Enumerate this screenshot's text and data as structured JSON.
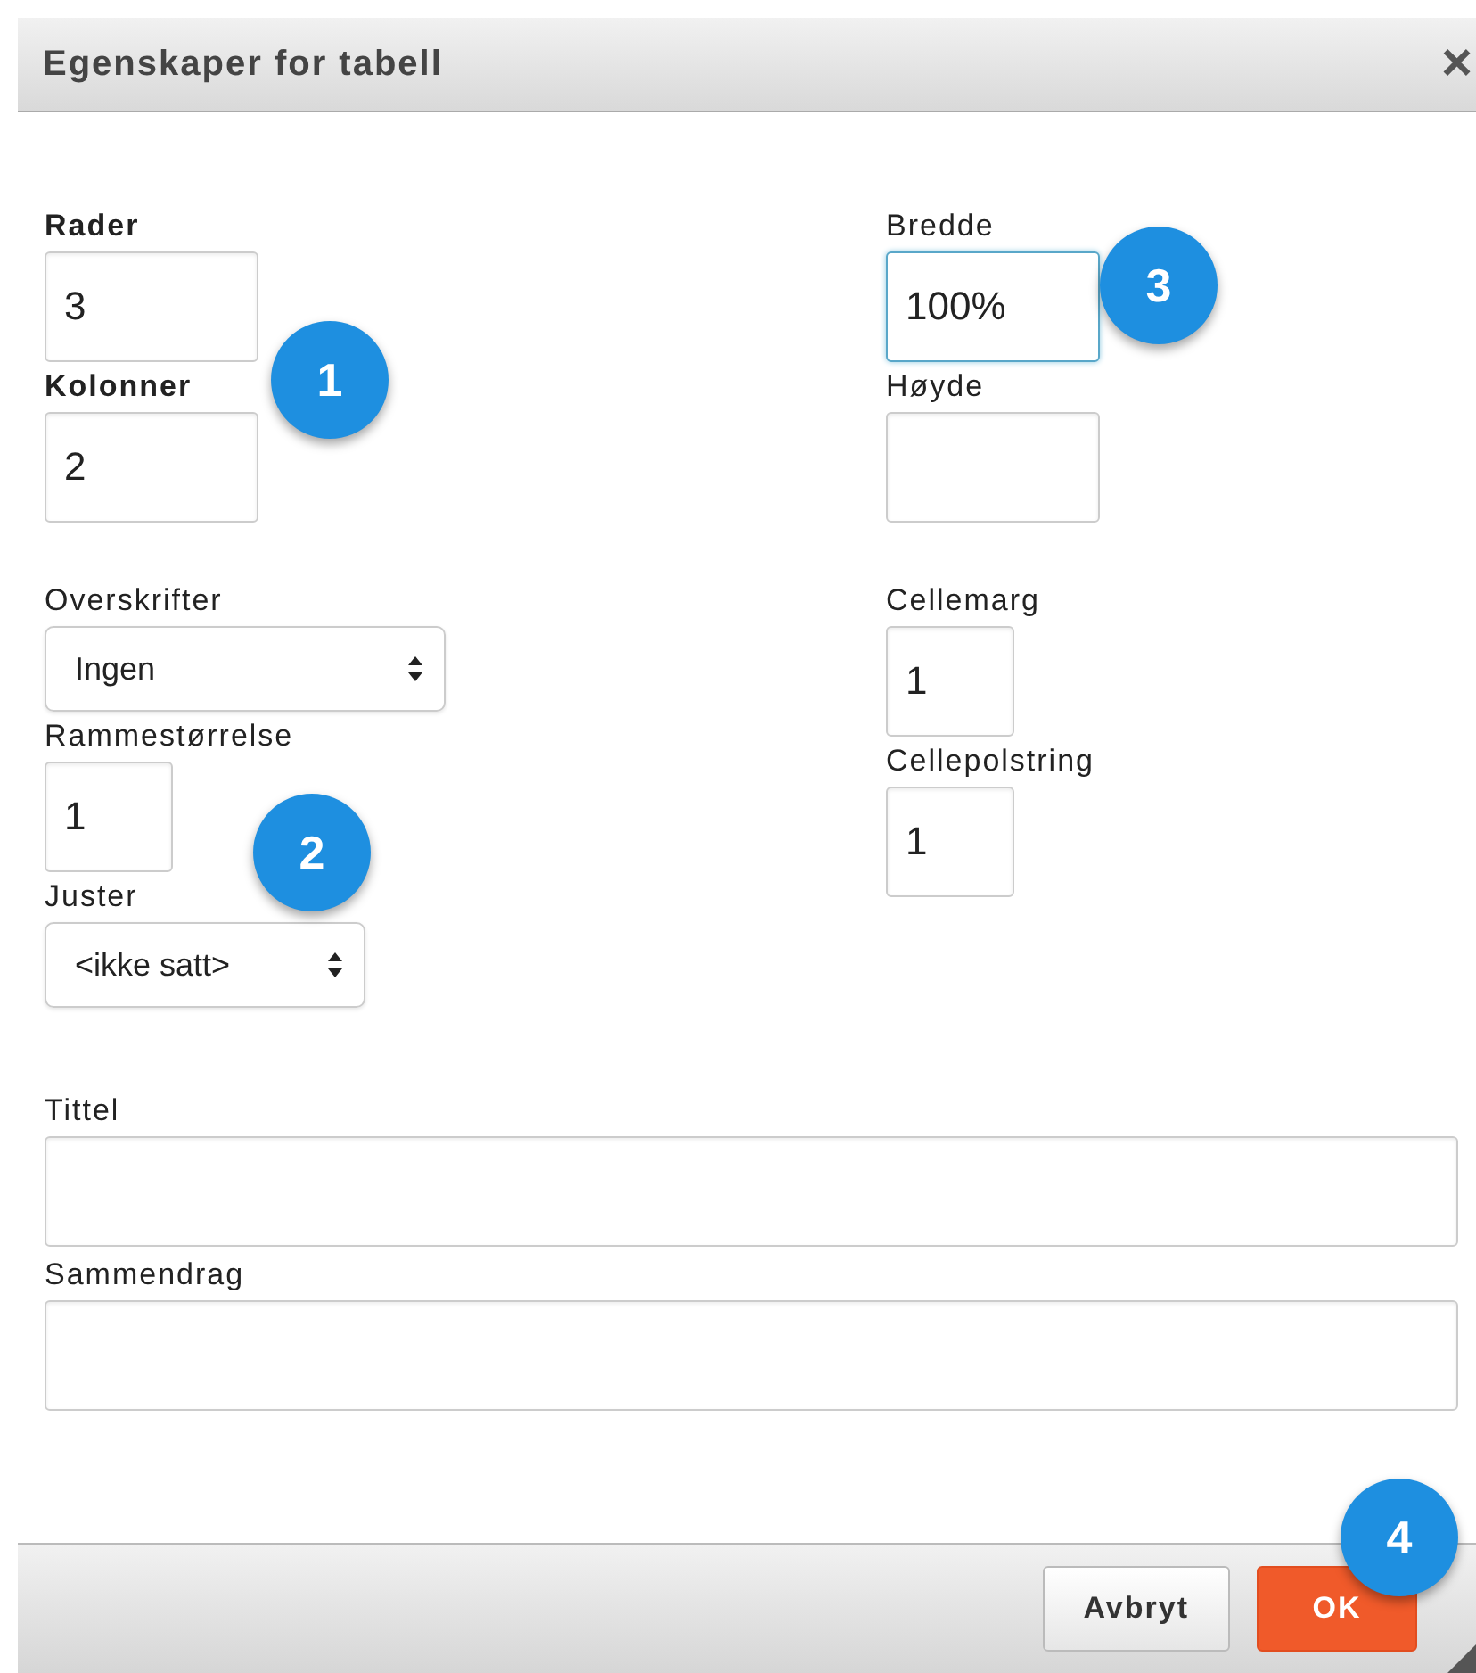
{
  "window": {
    "title": "Egenskaper for tabell",
    "close": "×"
  },
  "columns": [
    {
      "groups": [
        [
          {
            "label": "Rader",
            "bold": true,
            "kind": "text",
            "value": "3",
            "focused": false
          },
          {
            "label": "Kolonner",
            "bold": true,
            "kind": "text",
            "value": "2",
            "focused": false
          }
        ],
        [
          {
            "label": "Overskrifter",
            "bold": false,
            "kind": "select",
            "value": "Ingen"
          },
          {
            "label": "Rammestørrelse",
            "bold": false,
            "kind": "text",
            "value": "1",
            "focused": false
          },
          {
            "label": "Juster",
            "bold": false,
            "kind": "select",
            "value": "<ikke satt>"
          }
        ]
      ]
    },
    {
      "groups": [
        [
          {
            "label": "Bredde",
            "bold": false,
            "kind": "text",
            "value": "100%",
            "focused": true
          },
          {
            "label": "Høyde",
            "bold": false,
            "kind": "text",
            "focused": false
          }
        ],
        [
          {
            "label": "Cellemarg",
            "bold": false,
            "kind": "text",
            "value": "1",
            "focused": false
          },
          {
            "label": "Cellepolstring",
            "bold": false,
            "kind": "text",
            "value": "1",
            "focused": false
          }
        ]
      ]
    }
  ],
  "wide_fields": [
    {
      "label": "Tittel",
      "bold": false,
      "kind": "text",
      "focused": false
    },
    {
      "label": "Sammendrag",
      "bold": false,
      "kind": "text",
      "focused": false
    }
  ],
  "buttons": [
    {
      "label": "Avbryt",
      "kind": "secondary"
    },
    {
      "label": "OK",
      "kind": "primary"
    }
  ],
  "callouts": [
    {
      "number": "1"
    },
    {
      "number": "2"
    },
    {
      "number": "3"
    },
    {
      "number": "4"
    }
  ]
}
